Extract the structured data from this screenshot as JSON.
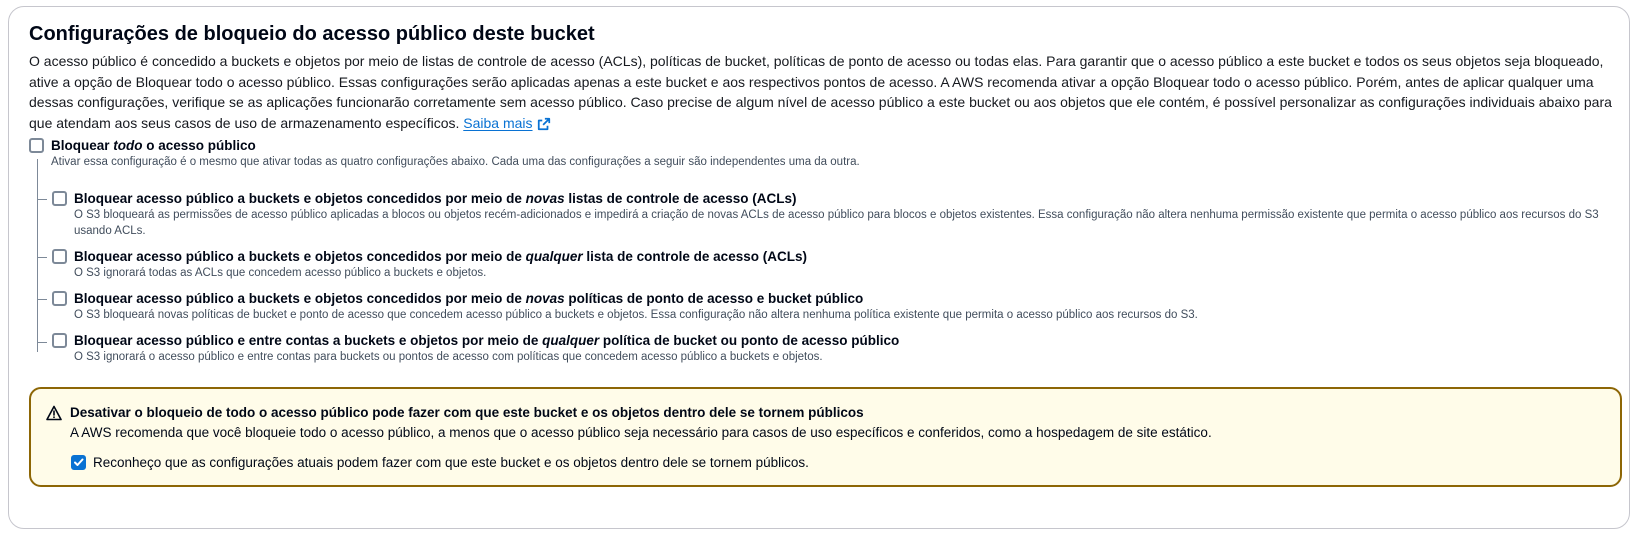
{
  "section": {
    "title": "Configurações de bloqueio do acesso público deste bucket",
    "description": "O acesso público é concedido a buckets e objetos por meio de listas de controle de acesso (ACLs), políticas de bucket, políticas de ponto de acesso ou todas elas. Para garantir que o acesso público a este bucket e todos os seus objetos seja bloqueado, ative a opção de Bloquear todo o acesso público. Essas configurações serão aplicadas apenas a este bucket e aos respectivos pontos de acesso. A AWS recomenda ativar a opção Bloquear todo o acesso público. Porém, antes de aplicar qualquer uma dessas configurações, verifique se as aplicações funcionarão corretamente sem acesso público. Caso precise de algum nível de acesso público a este bucket ou aos objetos que ele contém, é possível personalizar as configurações individuais abaixo para que atendam aos seus casos de uso de armazenamento específicos.",
    "learn_more": "Saiba mais"
  },
  "block_all": {
    "label_pre": "Bloquear ",
    "label_em": "todo",
    "label_post": " o acesso público",
    "description": "Ativar essa configuração é o mesmo que ativar todas as quatro configurações abaixo. Cada uma das configurações a seguir são independentes uma da outra.",
    "checked": false
  },
  "options": [
    {
      "label_pre": "Bloquear acesso público a buckets e objetos concedidos por meio de ",
      "label_em": "novas",
      "label_post": " listas de controle de acesso (ACLs)",
      "description": "O S3 bloqueará as permissões de acesso público aplicadas a blocos ou objetos recém-adicionados e impedirá a criação de novas ACLs de acesso público para blocos e objetos existentes. Essa configuração não altera nenhuma permissão existente que permita o acesso público aos recursos do S3 usando ACLs.",
      "checked": false
    },
    {
      "label_pre": "Bloquear acesso público a buckets e objetos concedidos por meio de ",
      "label_em": "qualquer",
      "label_post": " lista de controle de acesso (ACLs)",
      "description": "O S3 ignorará todas as ACLs que concedem acesso público a buckets e objetos.",
      "checked": false
    },
    {
      "label_pre": "Bloquear acesso público a buckets e objetos concedidos por meio de ",
      "label_em": "novas",
      "label_post": " políticas de ponto de acesso e bucket público",
      "description": "O S3 bloqueará novas políticas de bucket e ponto de acesso que concedem acesso público a buckets e objetos. Essa configuração não altera nenhuma política existente que permita o acesso público aos recursos do S3.",
      "checked": false
    },
    {
      "label_pre": "Bloquear acesso público e entre contas a buckets e objetos por meio de ",
      "label_em": "qualquer",
      "label_post": " política de bucket ou ponto de acesso público",
      "description": "O S3 ignorará o acesso público e entre contas para buckets ou pontos de acesso com políticas que concedem acesso público a buckets e objetos.",
      "checked": false
    }
  ],
  "warning": {
    "title": "Desativar o bloqueio de todo o acesso público pode fazer com que este bucket e os objetos dentro dele se tornem públicos",
    "text": "A AWS recomenda que você bloqueie todo o acesso público, a menos que o acesso público seja necessário para casos de uso específicos e conferidos, como a hospedagem de site estático.",
    "ack_label": "Reconheço que as configurações atuais podem fazer com que este bucket e os objetos dentro dele se tornem públicos.",
    "ack_checked": true
  },
  "colors": {
    "link": "#0972d3",
    "warning_border": "#8d6605",
    "warning_bg": "#fffce9",
    "checkbox_checked": "#0972d3"
  },
  "icons": [
    "external-link-icon",
    "warning-icon",
    "checkmark-icon"
  ]
}
